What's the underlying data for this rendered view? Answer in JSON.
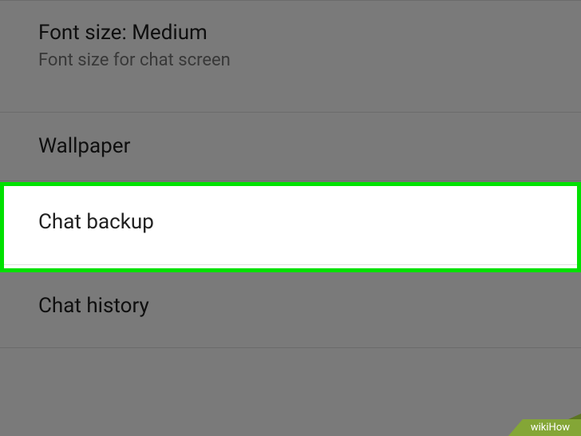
{
  "settings": {
    "font_size": {
      "title": "Font size: Medium",
      "subtitle": "Font size for chat screen"
    },
    "wallpaper": {
      "title": "Wallpaper"
    },
    "chat_backup": {
      "title": "Chat backup"
    },
    "chat_history": {
      "title": "Chat history"
    }
  },
  "watermark": {
    "text": "wikiHow"
  }
}
